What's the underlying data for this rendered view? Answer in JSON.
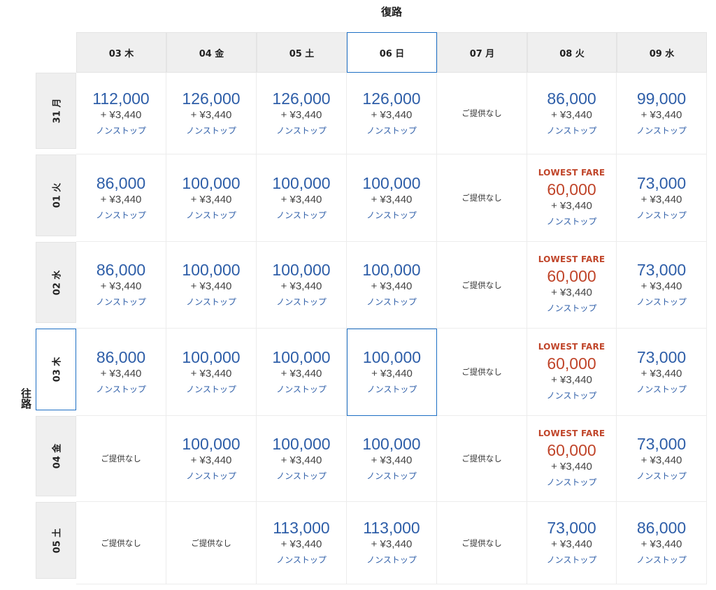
{
  "return_label": "復路",
  "outbound_label": "往路",
  "columns": [
    {
      "label": "03 木"
    },
    {
      "label": "04 金"
    },
    {
      "label": "05 土"
    },
    {
      "label": "06 日",
      "selected": true
    },
    {
      "label": "07 月"
    },
    {
      "label": "08 火"
    },
    {
      "label": "09 水"
    }
  ],
  "rows": [
    {
      "label": "31 月",
      "cells": [
        {
          "price": "112,000",
          "tax": "+ ¥3,440",
          "stops": "ノンストップ"
        },
        {
          "price": "126,000",
          "tax": "+ ¥3,440",
          "stops": "ノンストップ"
        },
        {
          "price": "126,000",
          "tax": "+ ¥3,440",
          "stops": "ノンストップ"
        },
        {
          "price": "126,000",
          "tax": "+ ¥3,440",
          "stops": "ノンストップ"
        },
        {
          "na": "ご提供なし"
        },
        {
          "price": "86,000",
          "tax": "+ ¥3,440",
          "stops": "ノンストップ"
        },
        {
          "price": "99,000",
          "tax": "+ ¥3,440",
          "stops": "ノンストップ"
        }
      ]
    },
    {
      "label": "01 火",
      "cells": [
        {
          "price": "86,000",
          "tax": "+ ¥3,440",
          "stops": "ノンストップ"
        },
        {
          "price": "100,000",
          "tax": "+ ¥3,440",
          "stops": "ノンストップ"
        },
        {
          "price": "100,000",
          "tax": "+ ¥3,440",
          "stops": "ノンストップ"
        },
        {
          "price": "100,000",
          "tax": "+ ¥3,440",
          "stops": "ノンストップ"
        },
        {
          "na": "ご提供なし"
        },
        {
          "badge": "LOWEST FARE",
          "price": "60,000",
          "tax": "+ ¥3,440",
          "stops": "ノンストップ",
          "lowest": true
        },
        {
          "price": "73,000",
          "tax": "+ ¥3,440",
          "stops": "ノンストップ"
        }
      ]
    },
    {
      "label": "02 水",
      "cells": [
        {
          "price": "86,000",
          "tax": "+ ¥3,440",
          "stops": "ノンストップ"
        },
        {
          "price": "100,000",
          "tax": "+ ¥3,440",
          "stops": "ノンストップ"
        },
        {
          "price": "100,000",
          "tax": "+ ¥3,440",
          "stops": "ノンストップ"
        },
        {
          "price": "100,000",
          "tax": "+ ¥3,440",
          "stops": "ノンストップ"
        },
        {
          "na": "ご提供なし"
        },
        {
          "badge": "LOWEST FARE",
          "price": "60,000",
          "tax": "+ ¥3,440",
          "stops": "ノンストップ",
          "lowest": true
        },
        {
          "price": "73,000",
          "tax": "+ ¥3,440",
          "stops": "ノンストップ"
        }
      ]
    },
    {
      "label": "03 木",
      "selected": true,
      "cells": [
        {
          "price": "86,000",
          "tax": "+ ¥3,440",
          "stops": "ノンストップ"
        },
        {
          "price": "100,000",
          "tax": "+ ¥3,440",
          "stops": "ノンストップ"
        },
        {
          "price": "100,000",
          "tax": "+ ¥3,440",
          "stops": "ノンストップ"
        },
        {
          "price": "100,000",
          "tax": "+ ¥3,440",
          "stops": "ノンストップ",
          "selected": true
        },
        {
          "na": "ご提供なし"
        },
        {
          "badge": "LOWEST FARE",
          "price": "60,000",
          "tax": "+ ¥3,440",
          "stops": "ノンストップ",
          "lowest": true
        },
        {
          "price": "73,000",
          "tax": "+ ¥3,440",
          "stops": "ノンストップ"
        }
      ]
    },
    {
      "label": "04 金",
      "cells": [
        {
          "na": "ご提供なし"
        },
        {
          "price": "100,000",
          "tax": "+ ¥3,440",
          "stops": "ノンストップ"
        },
        {
          "price": "100,000",
          "tax": "+ ¥3,440",
          "stops": "ノンストップ"
        },
        {
          "price": "100,000",
          "tax": "+ ¥3,440",
          "stops": "ノンストップ"
        },
        {
          "na": "ご提供なし"
        },
        {
          "badge": "LOWEST FARE",
          "price": "60,000",
          "tax": "+ ¥3,440",
          "stops": "ノンストップ",
          "lowest": true
        },
        {
          "price": "73,000",
          "tax": "+ ¥3,440",
          "stops": "ノンストップ"
        }
      ]
    },
    {
      "label": "05 土",
      "cells": [
        {
          "na": "ご提供なし"
        },
        {
          "na": "ご提供なし"
        },
        {
          "price": "113,000",
          "tax": "+ ¥3,440",
          "stops": "ノンストップ"
        },
        {
          "price": "113,000",
          "tax": "+ ¥3,440",
          "stops": "ノンストップ"
        },
        {
          "na": "ご提供なし"
        },
        {
          "price": "73,000",
          "tax": "+ ¥3,440",
          "stops": "ノンストップ"
        },
        {
          "price": "86,000",
          "tax": "+ ¥3,440",
          "stops": "ノンストップ"
        }
      ]
    }
  ],
  "colors": {
    "accent": "#1d6fc4",
    "price": "#2e5ea8",
    "lowest": "#c0452a",
    "header_bg": "#efefef"
  }
}
